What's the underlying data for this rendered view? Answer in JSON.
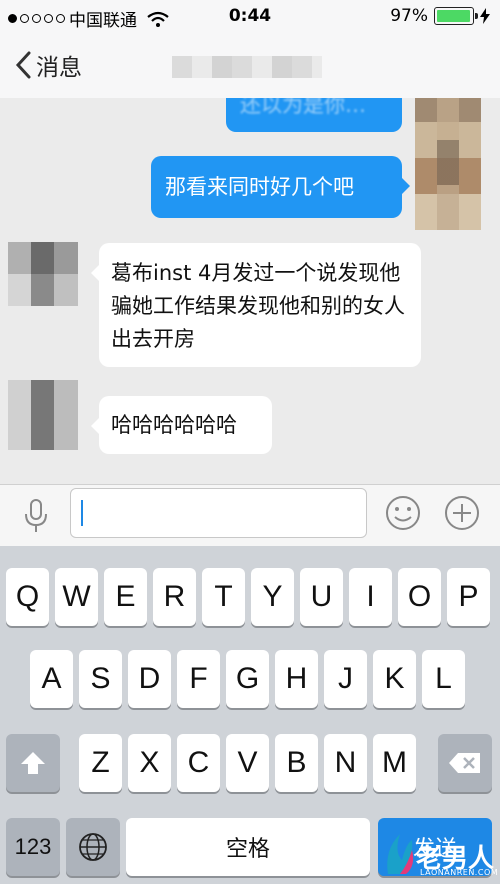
{
  "status_bar": {
    "carrier": "中国联通",
    "time": "0:44",
    "battery": "97%",
    "battery_level": 0.97
  },
  "nav": {
    "back_label": "消息"
  },
  "messages": [
    {
      "side": "out",
      "text": "还以为是你…"
    },
    {
      "side": "out",
      "text": "那看来同时好几个吧"
    },
    {
      "side": "in",
      "text": "葛布inst 4月发过一个说发现他骗她工作结果发现他和别的女人出去开房"
    },
    {
      "side": "in",
      "text": "哈哈哈哈哈哈"
    }
  ],
  "input": {
    "value": ""
  },
  "keyboard": {
    "row1": [
      "Q",
      "W",
      "E",
      "R",
      "T",
      "Y",
      "U",
      "I",
      "O",
      "P"
    ],
    "row2": [
      "A",
      "S",
      "D",
      "F",
      "G",
      "H",
      "J",
      "K",
      "L"
    ],
    "row3": [
      "Z",
      "X",
      "C",
      "V",
      "B",
      "N",
      "M"
    ],
    "num_key": "123",
    "space_key": "空格",
    "go_key": "发送"
  },
  "watermark": {
    "text": "老男人",
    "sub": "LAONANREN.COM"
  }
}
